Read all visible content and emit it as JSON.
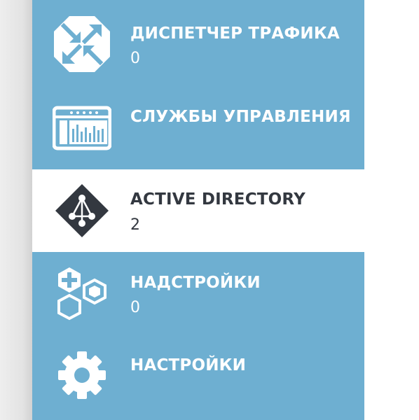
{
  "nav": {
    "items": [
      {
        "title": "ДИСПЕТЧЕР ТРАФИКА",
        "count": "0",
        "icon": "traffic-manager-icon",
        "selected": false
      },
      {
        "title": "СЛУЖБЫ УПРАВЛЕНИЯ",
        "count": "",
        "icon": "management-services-icon",
        "selected": false
      },
      {
        "title": "ACTIVE DIRECTORY",
        "count": "2",
        "icon": "active-directory-icon",
        "selected": true
      },
      {
        "title": "НАДСТРОЙКИ",
        "count": "0",
        "icon": "add-ons-icon",
        "selected": false
      },
      {
        "title": "НАСТРОЙКИ",
        "count": "",
        "icon": "gear-icon",
        "selected": false
      }
    ]
  },
  "colors": {
    "nav_background": "#6eafd1",
    "selected_background": "#ffffff",
    "selected_text": "#333840",
    "text": "#ffffff"
  }
}
